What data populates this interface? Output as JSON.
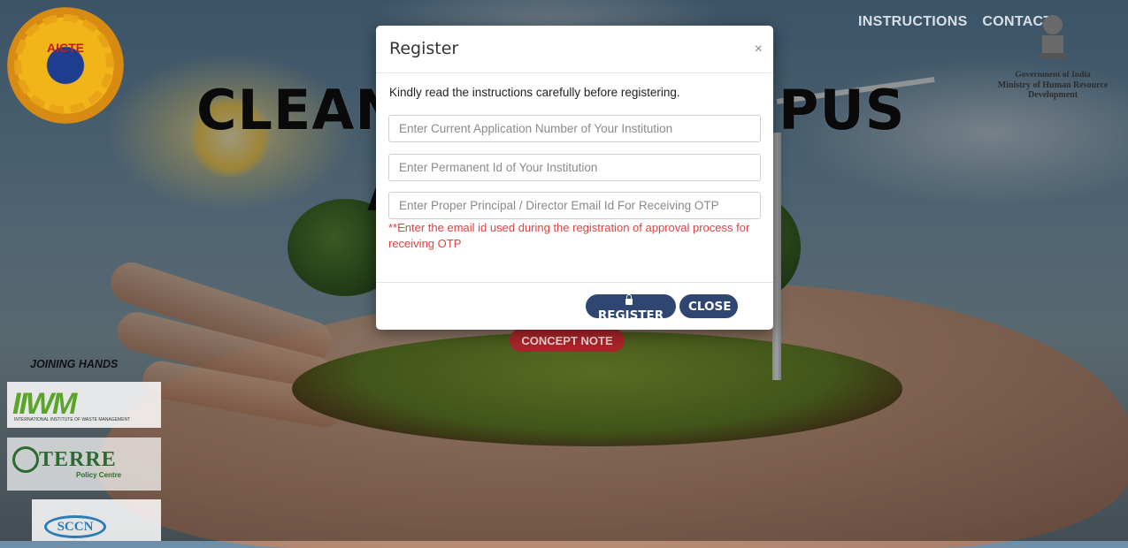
{
  "nav": {
    "instructions": "INSTRUCTIONS",
    "contact": "CONTACT"
  },
  "brand": {
    "aicte_logo_text": "AICTE"
  },
  "hero": {
    "title_left": "CLEAN",
    "title_right": "PUS",
    "title_second_line_letter": "A"
  },
  "govt": {
    "line1": "Government of India",
    "line2": "Ministry of Human Resource",
    "line3": "Development"
  },
  "sidebar": {
    "joining_label": "JOINING HANDS",
    "partners": [
      {
        "name": "IIWM",
        "subtitle": "INTERNATIONAL INSTITUTE OF WASTE MANAGEMENT"
      },
      {
        "name": "TERRE",
        "subtitle": "Policy Centre"
      },
      {
        "name": "SCCN"
      }
    ]
  },
  "concept_note_label": "CONCEPT NOTE",
  "modal": {
    "title": "Register",
    "close_glyph": "×",
    "instructions": "Kindly read the instructions carefully before registering.",
    "fields": {
      "application_number_placeholder": "Enter Current Application Number of Your Institution",
      "permanent_id_placeholder": "Enter Permanent Id of Your Institution",
      "email_placeholder": "Enter Proper Principal / Director Email Id For Receiving OTP"
    },
    "email_hint": "**Enter the email id used during the registration of approval process for receiving OTP",
    "register_label": "REGISTER",
    "close_label": "CLOSE"
  },
  "colors": {
    "modal_button": "#2f4672",
    "hint_red": "#e2413f",
    "concept_red": "#a8252b"
  }
}
